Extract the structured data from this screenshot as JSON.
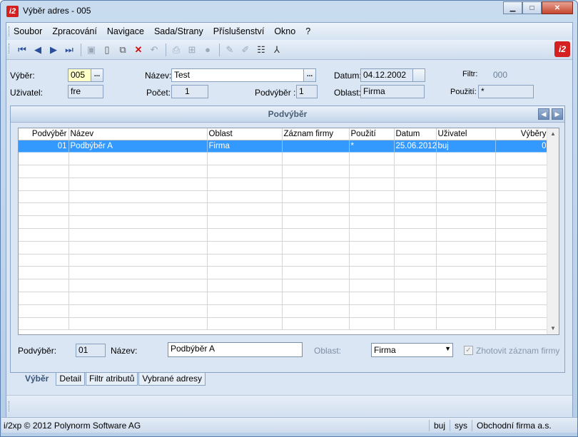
{
  "window": {
    "title": "Výběr adres - 005",
    "logo": "i2"
  },
  "menu": [
    "Soubor",
    "Zpracování",
    "Navigace",
    "Sada/Strany",
    "Příslušenství",
    "Okno",
    "?"
  ],
  "toolbar_icons": [
    "first-icon",
    "prev-icon",
    "next-icon",
    "last-icon",
    "save-icon",
    "new-icon",
    "copy-icon",
    "delete-icon",
    "undo-icon",
    "print-icon",
    "structure-icon",
    "disc-icon",
    "edit-icon",
    "pen-icon",
    "list-icon",
    "filter-icon"
  ],
  "header": {
    "vyber_label": "Výběr:",
    "vyber_value": "005",
    "nazev_label": "Název:",
    "nazev_value": "Test",
    "datum_label": "Datum:",
    "datum_value": "04.12.2002",
    "filtr_label": "Filtr:",
    "filtr_value": "000",
    "uzivatel_label": "Uživatel:",
    "uzivatel_value": "fre",
    "pocet_label": "Počet:",
    "pocet_value": "1",
    "podvyber_label": "Podvýběr :",
    "podvyber_value": "1",
    "oblast_label": "Oblast:",
    "oblast_value": "Firma",
    "pouziti_label": "Použití:",
    "pouziti_value": "*",
    "ellipsis": "..."
  },
  "panel": {
    "title": "Podvýběr"
  },
  "grid": {
    "columns": [
      "Podvýběr",
      "Název",
      "Oblast",
      "Záznam firmy",
      "Použití",
      "Datum",
      "Uživatel",
      "Výběry"
    ],
    "rows": [
      [
        "01",
        "Podbýběr A",
        "Firma",
        "",
        "*",
        "25.06.2012",
        "buj",
        "0"
      ]
    ]
  },
  "detail": {
    "podvyber_label": "Podvýběr:",
    "podvyber_value": "01",
    "nazev_label": "Název:",
    "nazev_value": "Podbýběr A",
    "oblast_label": "Oblast:",
    "oblast_value": "Firma",
    "zhotovit_label": "Zhotovit záznam firmy"
  },
  "tabs": [
    "Výběr",
    "Detail",
    "Filtr atributů",
    "Vybrané adresy"
  ],
  "status": {
    "copyright": "i/2xp © 2012 Polynorm Software AG",
    "user": "buj",
    "system": "sys",
    "company": "Obchodní firma a.s."
  }
}
